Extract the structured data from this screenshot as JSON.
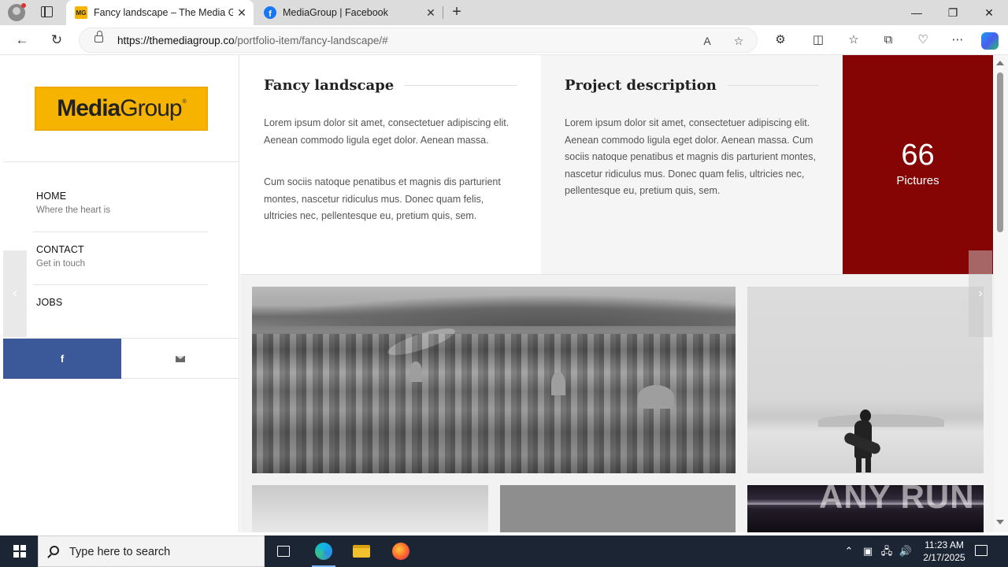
{
  "browser": {
    "tabs": [
      {
        "favicon": "MG",
        "title": "Fancy landscape – The Media Group",
        "active": true
      },
      {
        "favicon": "f",
        "title": "MediaGroup | Facebook",
        "active": false
      }
    ],
    "url": {
      "domain": "https://themediagroup.co",
      "path": "/portfolio-item/fancy-landscape/#"
    }
  },
  "sidebar": {
    "logo": {
      "bold": "Media",
      "light": "Group",
      "mark": "®"
    },
    "nav": [
      {
        "title": "HOME",
        "subtitle": "Where the heart is"
      },
      {
        "title": "CONTACT",
        "subtitle": "Get in touch"
      },
      {
        "title": "JOBS",
        "subtitle": ""
      }
    ],
    "social": {
      "facebook": "f"
    }
  },
  "content": {
    "left": {
      "heading": "Fancy landscape",
      "paragraphs": [
        "Lorem ipsum dolor sit amet, consectetuer adipiscing elit. Aenean commodo ligula eget dolor. Aenean massa.",
        "Cum sociis natoque penatibus et magnis dis parturient montes, nascetur ridiculus mus. Donec quam felis, ultricies nec, pellentesque eu, pretium quis, sem."
      ]
    },
    "right": {
      "heading": "Project description",
      "paragraphs": [
        "Lorem ipsum dolor sit amet, consectetuer adipiscing elit. Aenean commodo ligula eget dolor. Aenean massa. Cum sociis natoque penatibus et magnis dis parturient montes, nascetur ridiculus mus. Donec quam felis, ultricies nec, pellentesque eu, pretium quis, sem."
      ]
    },
    "stat": {
      "count": "66",
      "label": "Pictures"
    }
  },
  "watermark": "ANY RUN",
  "taskbar": {
    "search_placeholder": "Type here to search",
    "time": "11:23 AM",
    "date": "2/17/2025"
  },
  "colors": {
    "accent_red": "#850505",
    "logo_yellow": "#f6b400",
    "facebook_blue": "#3b5998"
  }
}
